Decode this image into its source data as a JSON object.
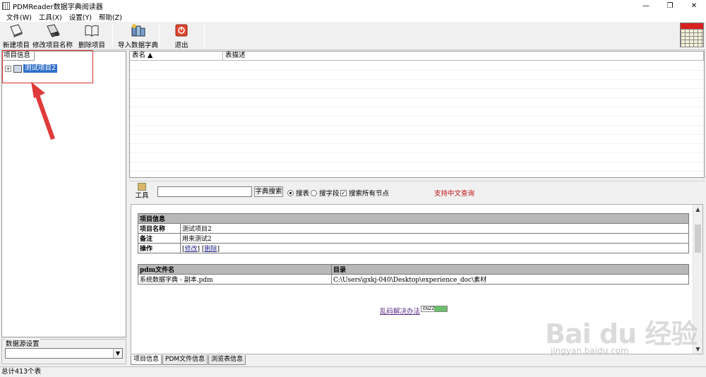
{
  "window": {
    "title": "PDMReader数据字典阅读器",
    "minimize": "—",
    "restore": "❐",
    "close": "✕"
  },
  "menu": [
    "文件(W)",
    "工具(X)",
    "设置(Y)",
    "帮助(Z)"
  ],
  "toolbar": {
    "new_project": "新建项目",
    "rename_project": "修改项目名称",
    "delete_project": "删除项目",
    "import_dict": "导入数据字典",
    "exit": "退出"
  },
  "left_panel": {
    "tab": "项目信息",
    "tree": [
      {
        "expander": "+",
        "label": "测试项目2",
        "selected": true
      }
    ]
  },
  "datasource": {
    "label": "数据源设置",
    "value": "",
    "arrow": "▼"
  },
  "table_list": {
    "columns": [
      "表名 ▲",
      "表描述"
    ]
  },
  "search": {
    "tool_label": "工具",
    "input_value": "",
    "search_button": "字典搜索",
    "opt_table": "搜表",
    "opt_field": "搜字段",
    "opt_all": "搜索所有节点",
    "hint": "支持中文查询",
    "table_selected": true,
    "all_checked": true
  },
  "project_info": {
    "header": "项目信息",
    "rows": [
      {
        "key": "项目名称",
        "value": "测试项目2"
      },
      {
        "key": "备注",
        "value": "用来测试2"
      }
    ],
    "op_key": "操作",
    "op_edit": "修改",
    "op_delete": "删除"
  },
  "pdm_files": {
    "columns": [
      "pdm文件名",
      "目录"
    ],
    "rows": [
      {
        "name": "系统数据字典 - 副本.pdm",
        "dir": "C:\\Users\\gxkj-040\\Desktop\\experience_doc\\素材"
      }
    ]
  },
  "garble_link": "乱码解决办法",
  "garble_badge": "ENZZ",
  "bottom_tabs": [
    "项目信息",
    "PDM文件信息",
    "浏览表信息"
  ],
  "status": "总计413个表",
  "watermark": {
    "text": "Bai du 经验",
    "url": "jingyan.baidu.com"
  },
  "colors": {
    "selection": "#3070c8",
    "annotation": "#e03030",
    "hint": "#c01010"
  }
}
